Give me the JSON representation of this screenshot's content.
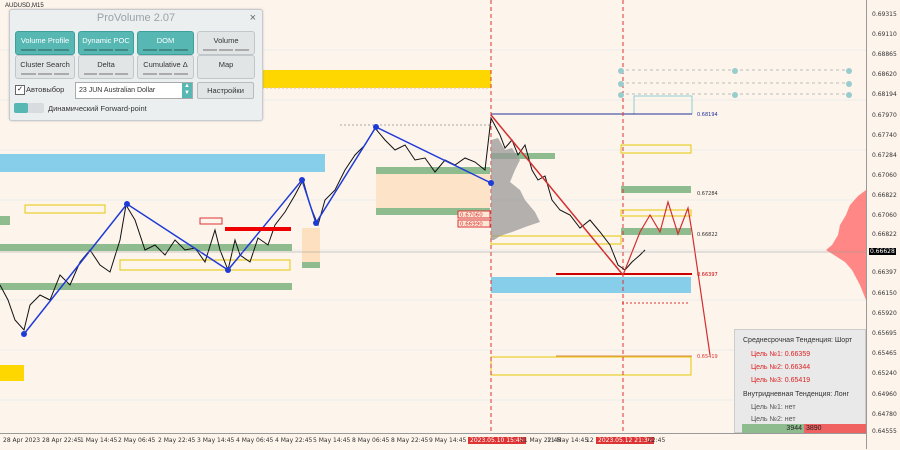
{
  "chart": {
    "symbol": "AUDUSD,M15",
    "price_labels": [
      "0.69315",
      "0.69110",
      "0.68865",
      "0.68620",
      "0.68194",
      "0.67970",
      "0.67740",
      "0.67284",
      "0.67060",
      "0.66822",
      "0.66628",
      "0.66397",
      "0.66150",
      "0.65920",
      "0.65695",
      "0.65465",
      "0.65240",
      "0.64960",
      "0.64780",
      "0.64555"
    ],
    "current_price": "0.66628",
    "time_labels": [
      "28 Apr 2023",
      "28 Apr 22:45",
      "1 May 14:45",
      "2 May 06:45",
      "2 May 22:45",
      "3 May 14:45",
      "4 May 06:45",
      "4 May 22:45",
      "5 May 14:45",
      "8 May 06:45",
      "8 May 22:45",
      "9 May 14:45",
      "2023.05.10 15:45",
      "11 May 22:45",
      "11 May 14:45",
      "12 May",
      "2023.05.12 21:30",
      "22:45"
    ],
    "level_tags": [
      "0.67060",
      "0.66990"
    ],
    "right_tags": [
      "0.68194",
      "0.67284",
      "0.66822",
      "0.66397",
      "0.65419"
    ]
  },
  "panel": {
    "title": "ProVolume 2.07",
    "close": "×",
    "buttons": {
      "volume_profile": "Volume Profile",
      "dynamic_poc": "Dynamic POC",
      "dom": "DOM",
      "volume": "Volume",
      "cluster_search": "Cluster Search",
      "delta": "Delta",
      "cumulative_delta": "Cumulative Δ",
      "map": "Map"
    },
    "auto_select_label": "Автовыбор",
    "auto_select_checked": "✓",
    "contract_value": "23 JUN Australian Dollar",
    "settings_label": "Настройки",
    "forward_point_label": "Динамический Forward-point"
  },
  "trend": {
    "mid_title": "Среднесрочная Тенденция: Шорт",
    "mid_targets": [
      "Цель №1: 0.66359",
      "Цель №2: 0.66344",
      "Цель №3: 0.65419"
    ],
    "intra_title": "Внутридневная Тенденция: Лонг",
    "intra_targets": [
      "Цель №1: нет",
      "Цель №2: нет"
    ],
    "buy_volume": "3944",
    "sell_volume": "3890"
  },
  "colors": {
    "background": "#fdf4ec",
    "accent": "#56b7b3",
    "blue_zone": "#87ceeb",
    "green_zone": "#8fbc8f",
    "yellow_zone": "#ffd700",
    "bear_line": "#d32f2f",
    "bull_line": "#1f3bd6"
  }
}
